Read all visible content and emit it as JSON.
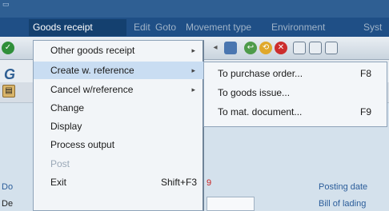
{
  "menubar": {
    "goods_receipt": "Goods receipt",
    "edit": "Edit",
    "goto": "Goto",
    "movement_type": "Movement type",
    "environment": "Environment",
    "system": "Syst"
  },
  "app": {
    "title_initial": "G"
  },
  "dropdown": [
    {
      "label": "Other goods receipt",
      "has_submenu": true,
      "enabled": true
    },
    {
      "label": "Create w. reference",
      "has_submenu": true,
      "enabled": true,
      "selected": true
    },
    {
      "label": "Cancel w/reference",
      "has_submenu": true,
      "enabled": true
    },
    {
      "label": "Change",
      "has_submenu": false,
      "enabled": true
    },
    {
      "label": "Display",
      "has_submenu": false,
      "enabled": true
    },
    {
      "label": "Process output",
      "has_submenu": false,
      "enabled": true
    },
    {
      "label": "Post",
      "has_submenu": false,
      "enabled": false
    },
    {
      "label": "Exit",
      "shortcut": "Shift+F3",
      "enabled": true
    }
  ],
  "submenu": [
    {
      "label": "To purchase order...",
      "shortcut": "F8"
    },
    {
      "label": "To goods issue...",
      "shortcut": ""
    },
    {
      "label": "To mat. document...",
      "shortcut": "F9"
    }
  ],
  "fields": {
    "left1": "Do",
    "left2": "De",
    "red_value": "9",
    "posting_date": "Posting date",
    "bill_of_lading": "Bill of lading"
  },
  "colors": {
    "menubar_bg": "#1f4f86",
    "highlight": "#c9ddf2",
    "link_text": "#2b5d9a"
  }
}
